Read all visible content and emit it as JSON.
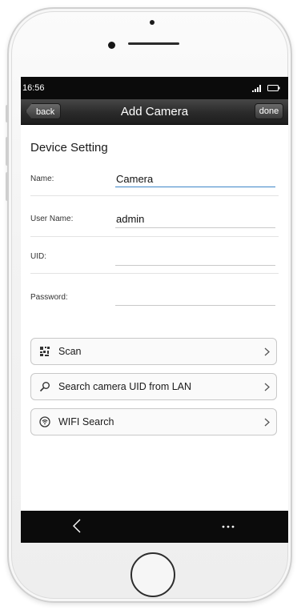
{
  "status_bar": {
    "time": "16:56",
    "signal_icon": "signal-icon",
    "battery_icon": "battery-icon"
  },
  "nav": {
    "title": "Add Camera",
    "back_label": "back",
    "done_label": "done"
  },
  "form": {
    "section_title": "Device Setting",
    "fields": [
      {
        "label": "Name:",
        "value": "Camera"
      },
      {
        "label": "User Name:",
        "value": "admin"
      },
      {
        "label": "UID:",
        "value": ""
      },
      {
        "label": "Password:",
        "value": ""
      }
    ]
  },
  "actions": [
    {
      "label": "Scan",
      "icon": "qr-scan-icon"
    },
    {
      "label": "Search camera UID from LAN",
      "icon": "search-icon"
    },
    {
      "label": "WIFI Search",
      "icon": "wifi-icon"
    }
  ],
  "colors": {
    "nav_bar": "#2a2a2a",
    "accent_underline": "#3d86c9",
    "bottom_bar": "#0b0b0b"
  }
}
